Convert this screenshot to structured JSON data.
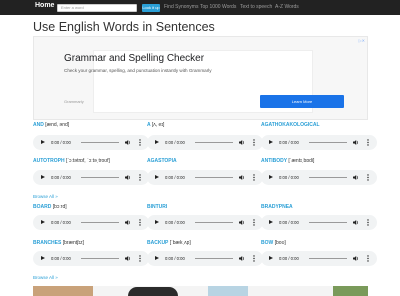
{
  "navbar": {
    "home_label": "Home",
    "search_placeholder": "Enter a word",
    "lookup_label": "Look it up",
    "links": [
      "Find Synonyms",
      "Top 1000 Words",
      "Text to speech",
      "A-Z Words"
    ]
  },
  "page_title": "Use English Words in Sentences",
  "ad": {
    "title": "Grammar and Spelling Checker",
    "description": "Check your grammar, spelling, and punctuation instantly with Grammarly",
    "source": "Grammarly",
    "button": "Learn More"
  },
  "player_time": "0:00 / 0:00",
  "words_group1": [
    {
      "word": "AND",
      "ipa": "[ænd, ənd]"
    },
    {
      "word": "A",
      "ipa": "[ʌ, eɪ]"
    },
    {
      "word": "AGATHOKAKOLOGICAL",
      "ipa": ""
    },
    {
      "word": "AUTOTROPH",
      "ipa": "[ˈɔːtətrɒf, ˈɔːtəˌtroʊf]"
    },
    {
      "word": "AGASTOPIA",
      "ipa": ""
    },
    {
      "word": "ANTIBODY",
      "ipa": "[ˈæntɪˌbɒdi]"
    }
  ],
  "words_group2": [
    {
      "word": "BOARD",
      "ipa": "[bɔːrd]"
    },
    {
      "word": "BINTURI",
      "ipa": ""
    },
    {
      "word": "BRADYPNEA",
      "ipa": ""
    },
    {
      "word": "BRANCHES",
      "ipa": "[bræntʃɪz]"
    },
    {
      "word": "BACKUP",
      "ipa": "[ˈbækˌʌp]"
    },
    {
      "word": "BOW",
      "ipa": "[boʊ]"
    }
  ],
  "browse_all": "Browse All »"
}
